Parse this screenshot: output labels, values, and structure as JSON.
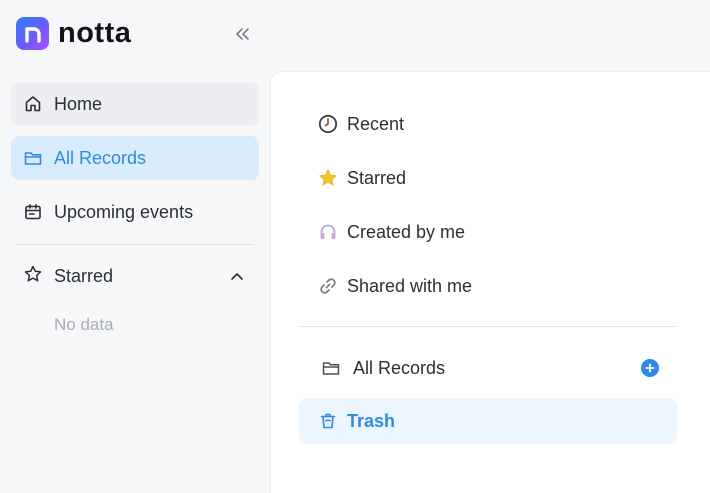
{
  "app": {
    "logo_text": "notta"
  },
  "sidebar": {
    "items": [
      {
        "label": "Home"
      },
      {
        "label": "All Records"
      },
      {
        "label": "Upcoming events"
      }
    ],
    "starred": {
      "label": "Starred",
      "empty_text": "No data"
    }
  },
  "main": {
    "filters": [
      {
        "label": "Recent",
        "icon": "clock-icon"
      },
      {
        "label": "Starred",
        "icon": "star-icon"
      },
      {
        "label": "Created by me",
        "icon": "headphones-icon"
      },
      {
        "label": "Shared with me",
        "icon": "link-icon"
      }
    ],
    "folders": [
      {
        "label": "All Records",
        "icon": "folder-icon"
      },
      {
        "label": "Trash",
        "icon": "trash-icon"
      }
    ]
  },
  "colors": {
    "accent": "#2f8ae0",
    "active_bg": "#d8ecfd",
    "trash_bg": "#eaf5fd"
  }
}
